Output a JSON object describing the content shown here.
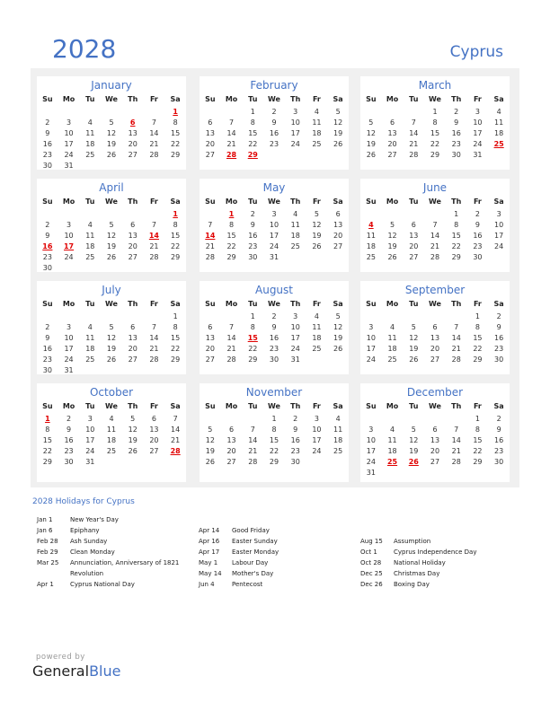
{
  "header": {
    "year": "2028",
    "country": "Cyprus"
  },
  "dow": [
    "Su",
    "Mo",
    "Tu",
    "We",
    "Th",
    "Fr",
    "Sa"
  ],
  "colors": {
    "accent": "#4472c4",
    "holiday": "#e00000",
    "panel": "#f0f0f0"
  },
  "months": [
    {
      "name": "January",
      "start": 6,
      "days": 31,
      "holidays": [
        1,
        6
      ]
    },
    {
      "name": "February",
      "start": 2,
      "days": 29,
      "holidays": [
        28,
        29
      ]
    },
    {
      "name": "March",
      "start": 3,
      "days": 31,
      "holidays": [
        25
      ]
    },
    {
      "name": "April",
      "start": 6,
      "days": 30,
      "holidays": [
        1,
        14,
        16,
        17
      ]
    },
    {
      "name": "May",
      "start": 1,
      "days": 31,
      "holidays": [
        1,
        14
      ]
    },
    {
      "name": "June",
      "start": 4,
      "days": 30,
      "holidays": [
        4
      ]
    },
    {
      "name": "July",
      "start": 6,
      "days": 31,
      "holidays": []
    },
    {
      "name": "August",
      "start": 2,
      "days": 31,
      "holidays": [
        15
      ]
    },
    {
      "name": "September",
      "start": 5,
      "days": 30,
      "holidays": []
    },
    {
      "name": "October",
      "start": 0,
      "days": 31,
      "holidays": [
        1,
        28
      ]
    },
    {
      "name": "November",
      "start": 3,
      "days": 30,
      "holidays": []
    },
    {
      "name": "December",
      "start": 5,
      "days": 31,
      "holidays": [
        25,
        26
      ]
    }
  ],
  "holidays_title": "2028 Holidays for Cyprus",
  "holiday_columns": [
    [
      {
        "date": "Jan 1",
        "name": "New Year's Day"
      },
      {
        "date": "Jan 6",
        "name": "Epiphany"
      },
      {
        "date": "Feb 28",
        "name": "Ash Sunday"
      },
      {
        "date": "Feb 29",
        "name": "Clean Monday"
      },
      {
        "date": "Mar 25",
        "name": "Annunciation, Anniversary of 1821"
      },
      {
        "date": "",
        "name": "Revolution"
      },
      {
        "date": "Apr 1",
        "name": "Cyprus National Day"
      }
    ],
    [
      {
        "date": "Apr 14",
        "name": "Good Friday"
      },
      {
        "date": "Apr 16",
        "name": "Easter Sunday"
      },
      {
        "date": "Apr 17",
        "name": "Easter Monday"
      },
      {
        "date": "May 1",
        "name": "Labour Day"
      },
      {
        "date": "May 14",
        "name": "Mother's Day"
      },
      {
        "date": "Jun 4",
        "name": "Pentecost"
      }
    ],
    [
      {
        "date": "Aug 15",
        "name": "Assumption"
      },
      {
        "date": "Oct 1",
        "name": "Cyprus Independence Day"
      },
      {
        "date": "Oct 28",
        "name": "National Holiday"
      },
      {
        "date": "Dec 25",
        "name": "Christmas Day"
      },
      {
        "date": "Dec 26",
        "name": "Boxing Day"
      }
    ]
  ],
  "footer": {
    "powered_by": "powered by",
    "brand_part1": "General",
    "brand_part2": "Blue"
  }
}
